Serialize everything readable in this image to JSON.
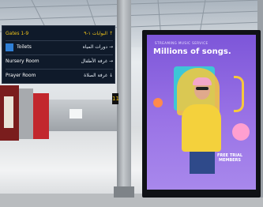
{
  "sign_board": {
    "rows": [
      {
        "label": "Gates 1-9",
        "arabic": "البوابات ١-٩",
        "arrow": "↑",
        "color": "#f0c419"
      },
      {
        "label": "Toilets",
        "arabic": "دورات المياه",
        "arrow": "→"
      },
      {
        "label": "Nursery Room",
        "arabic": "غرفة الأطفال",
        "arrow": "→"
      },
      {
        "label": "Prayer Room",
        "arabic": "غرفة الصلاة",
        "arrow": "↓"
      }
    ],
    "toilet_icon": "toilet-icon",
    "gate_number": "11"
  },
  "advertisement": {
    "eyebrow": "STREAMING MUSIC SERVICE",
    "headline": "Millions of songs.",
    "footer": "FREE TRIAL MEMBERS",
    "accent_color": "#8a63e0"
  }
}
